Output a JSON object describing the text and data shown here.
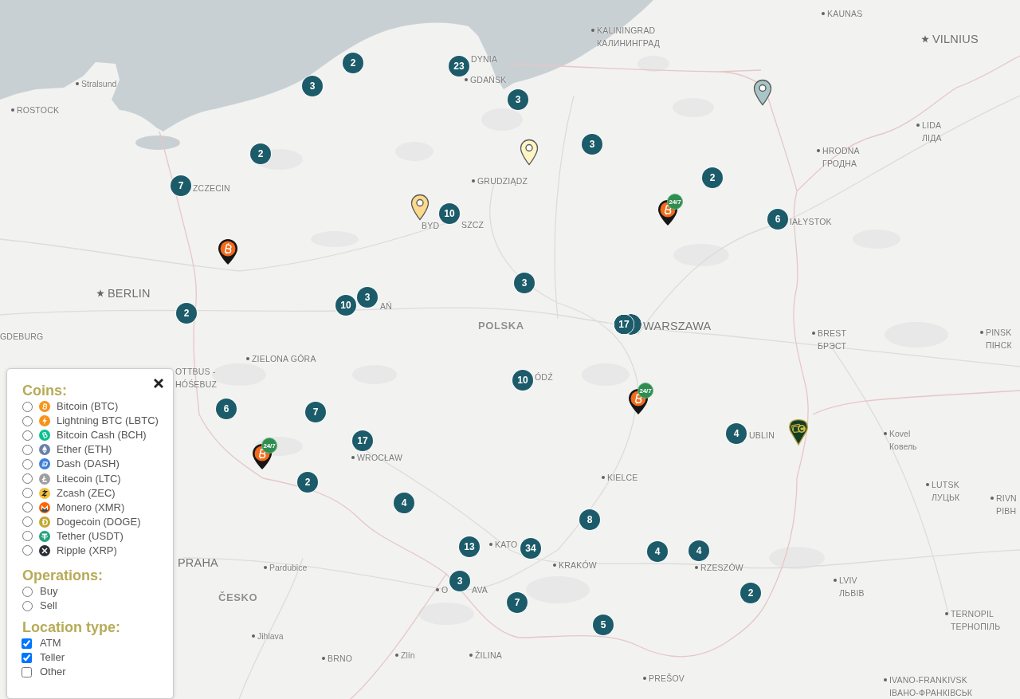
{
  "map": {
    "clusters": [
      {
        "count": "2",
        "stacked": false
      },
      {
        "count": "3",
        "stacked": false
      },
      {
        "count": "23",
        "stacked": false
      },
      {
        "count": "3",
        "stacked": false
      },
      {
        "count": "2",
        "stacked": false
      },
      {
        "count": "7",
        "stacked": false
      },
      {
        "count": "3",
        "stacked": false
      },
      {
        "count": "2",
        "stacked": false
      },
      {
        "count": "10",
        "stacked": false
      },
      {
        "count": "6",
        "stacked": false
      },
      {
        "count": "3",
        "stacked": false
      },
      {
        "count": "10",
        "stacked": false
      },
      {
        "count": "3",
        "stacked": false
      },
      {
        "count": "2",
        "stacked": false
      },
      {
        "count": "17",
        "stacked": true
      },
      {
        "count": "10",
        "stacked": false
      },
      {
        "count": "6",
        "stacked": false
      },
      {
        "count": "7",
        "stacked": false
      },
      {
        "count": "17",
        "stacked": false
      },
      {
        "count": "2",
        "stacked": false
      },
      {
        "count": "4",
        "stacked": false
      },
      {
        "count": "4",
        "stacked": false
      },
      {
        "count": "8",
        "stacked": false
      },
      {
        "count": "13",
        "stacked": false
      },
      {
        "count": "34",
        "stacked": false
      },
      {
        "count": "4",
        "stacked": false
      },
      {
        "count": "4",
        "stacked": false
      },
      {
        "count": "3",
        "stacked": false
      },
      {
        "count": "7",
        "stacked": false
      },
      {
        "count": "2",
        "stacked": false
      },
      {
        "count": "5",
        "stacked": false
      }
    ],
    "pins": [
      {
        "kind": "location",
        "color": "#a9c6c7"
      },
      {
        "kind": "location",
        "color": "#fff5c4"
      },
      {
        "kind": "location",
        "color": "#fcd98c"
      },
      {
        "kind": "bitcoin"
      },
      {
        "kind": "bitcoin",
        "badge": "24/7"
      },
      {
        "kind": "bitcoin",
        "badge": "24/7"
      },
      {
        "kind": "bitcoin",
        "badge": "24/7"
      },
      {
        "kind": "cash"
      }
    ],
    "labels": [
      {
        "kind": "town",
        "lines": [
          "Stralsund"
        ]
      },
      {
        "kind": "city",
        "lines": [
          "ROSTOCK"
        ]
      },
      {
        "kind": "name",
        "lines": [
          "DYNIA"
        ]
      },
      {
        "kind": "city",
        "lines": [
          "GDAŃSK"
        ]
      },
      {
        "kind": "city",
        "lines": [
          "KALININGRAD",
          "КАЛИНИНГРАД"
        ]
      },
      {
        "kind": "city",
        "lines": [
          "KAUNAS"
        ]
      },
      {
        "kind": "capital",
        "lines": [
          "VILNIUS"
        ]
      },
      {
        "kind": "city",
        "lines": [
          "LIDA",
          "ЛІДА"
        ]
      },
      {
        "kind": "city",
        "lines": [
          "HRODNA",
          "ГРОДНА"
        ]
      },
      {
        "kind": "city",
        "lines": [
          "GRUDZIĄDZ"
        ]
      },
      {
        "kind": "name",
        "lines": [
          "ZCZECIN"
        ]
      },
      {
        "kind": "name",
        "lines": [
          "BYD"
        ]
      },
      {
        "kind": "name",
        "lines": [
          "SZCZ"
        ]
      },
      {
        "kind": "name",
        "lines": [
          "IAŁYSTOK"
        ]
      },
      {
        "kind": "capital",
        "lines": [
          "BERLIN"
        ]
      },
      {
        "kind": "name",
        "lines": [
          "AŃ"
        ]
      },
      {
        "kind": "name",
        "lines": [
          "GDEBURG"
        ]
      },
      {
        "kind": "country",
        "lines": [
          "POLSKA"
        ]
      },
      {
        "kind": "bigname",
        "lines": [
          "WARSZAWA"
        ]
      },
      {
        "kind": "city",
        "lines": [
          "BREST",
          "БРЭСТ"
        ]
      },
      {
        "kind": "city",
        "lines": [
          "PINSK",
          "ПІНСК"
        ]
      },
      {
        "kind": "city",
        "lines": [
          "ZIELONA GÓRA"
        ]
      },
      {
        "kind": "name",
        "lines": [
          "OTTBUS -",
          "HÓŚEBUZ"
        ]
      },
      {
        "kind": "name",
        "lines": [
          "ÓDŹ"
        ]
      },
      {
        "kind": "city",
        "lines": [
          "WROCŁAW"
        ]
      },
      {
        "kind": "city",
        "lines": [
          "KIELCE"
        ]
      },
      {
        "kind": "name",
        "lines": [
          "UBLIN"
        ]
      },
      {
        "kind": "town",
        "lines": [
          "Kovel",
          "Ковель"
        ]
      },
      {
        "kind": "city",
        "lines": [
          "LUTSK",
          "ЛУЦЬК"
        ]
      },
      {
        "kind": "city",
        "lines": [
          "RIVN",
          "РІВН"
        ]
      },
      {
        "kind": "bigname",
        "lines": [
          "PRAHA"
        ]
      },
      {
        "kind": "town",
        "lines": [
          "Pardubice"
        ]
      },
      {
        "kind": "country",
        "lines": [
          "ČESKO"
        ]
      },
      {
        "kind": "city",
        "lines": [
          "KATO"
        ]
      },
      {
        "kind": "city",
        "lines": [
          "KRAKÓW"
        ]
      },
      {
        "kind": "city",
        "lines": [
          "RZESZÓW"
        ]
      },
      {
        "kind": "city",
        "lines": [
          "O"
        ]
      },
      {
        "kind": "name",
        "lines": [
          "AVA"
        ]
      },
      {
        "kind": "city",
        "lines": [
          "LVIV",
          "ЛЬВІВ"
        ]
      },
      {
        "kind": "city",
        "lines": [
          "TERNOPIL",
          "ТЕРНОПІЛЬ"
        ]
      },
      {
        "kind": "town",
        "lines": [
          "Jihlava"
        ]
      },
      {
        "kind": "city",
        "lines": [
          "BRNO"
        ]
      },
      {
        "kind": "town",
        "lines": [
          "Zlín"
        ]
      },
      {
        "kind": "city",
        "lines": [
          "ŽILINA"
        ]
      },
      {
        "kind": "city",
        "lines": [
          "PREŠOV"
        ]
      },
      {
        "kind": "city",
        "lines": [
          "IVANO-FRANKIVSK",
          "ІВАНО-ФРАНКІВСЬК"
        ]
      }
    ]
  },
  "filter_panel": {
    "coins": {
      "title": "Coins:",
      "items": [
        {
          "label": "Bitcoin (BTC)",
          "kind": "btc",
          "color": "#f7931a",
          "selected": false
        },
        {
          "label": "Lightning BTC (LBTC)",
          "kind": "lbtc",
          "color": "#f7931a",
          "selected": false
        },
        {
          "label": "Bitcoin Cash (BCH)",
          "kind": "bch",
          "color": "#0ac18e",
          "selected": false
        },
        {
          "label": "Ether (ETH)",
          "kind": "eth",
          "color": "#6a80a9",
          "selected": false
        },
        {
          "label": "Dash (DASH)",
          "kind": "dash",
          "color": "#3d7fd8",
          "selected": false
        },
        {
          "label": "Litecoin (LTC)",
          "kind": "ltc",
          "color": "#9e9e9e",
          "selected": false
        },
        {
          "label": "Zcash (ZEC)",
          "kind": "zec",
          "color": "#f5bf3c",
          "selected": false
        },
        {
          "label": "Monero (XMR)",
          "kind": "xmr",
          "color": "#ff6600",
          "selected": false
        },
        {
          "label": "Dogecoin (DOGE)",
          "kind": "doge",
          "color": "#c2a633",
          "selected": false
        },
        {
          "label": "Tether (USDT)",
          "kind": "usdt",
          "color": "#26a17b",
          "selected": false
        },
        {
          "label": "Ripple (XRP)",
          "kind": "xrp",
          "color": "#2b2f36",
          "selected": false
        }
      ]
    },
    "operations": {
      "title": "Operations:",
      "items": [
        {
          "label": "Buy",
          "selected": false
        },
        {
          "label": "Sell",
          "selected": false
        }
      ]
    },
    "location_type": {
      "title": "Location type:",
      "items": [
        {
          "label": "ATM",
          "checked": true
        },
        {
          "label": "Teller",
          "checked": true
        },
        {
          "label": "Other",
          "checked": false
        }
      ]
    }
  }
}
